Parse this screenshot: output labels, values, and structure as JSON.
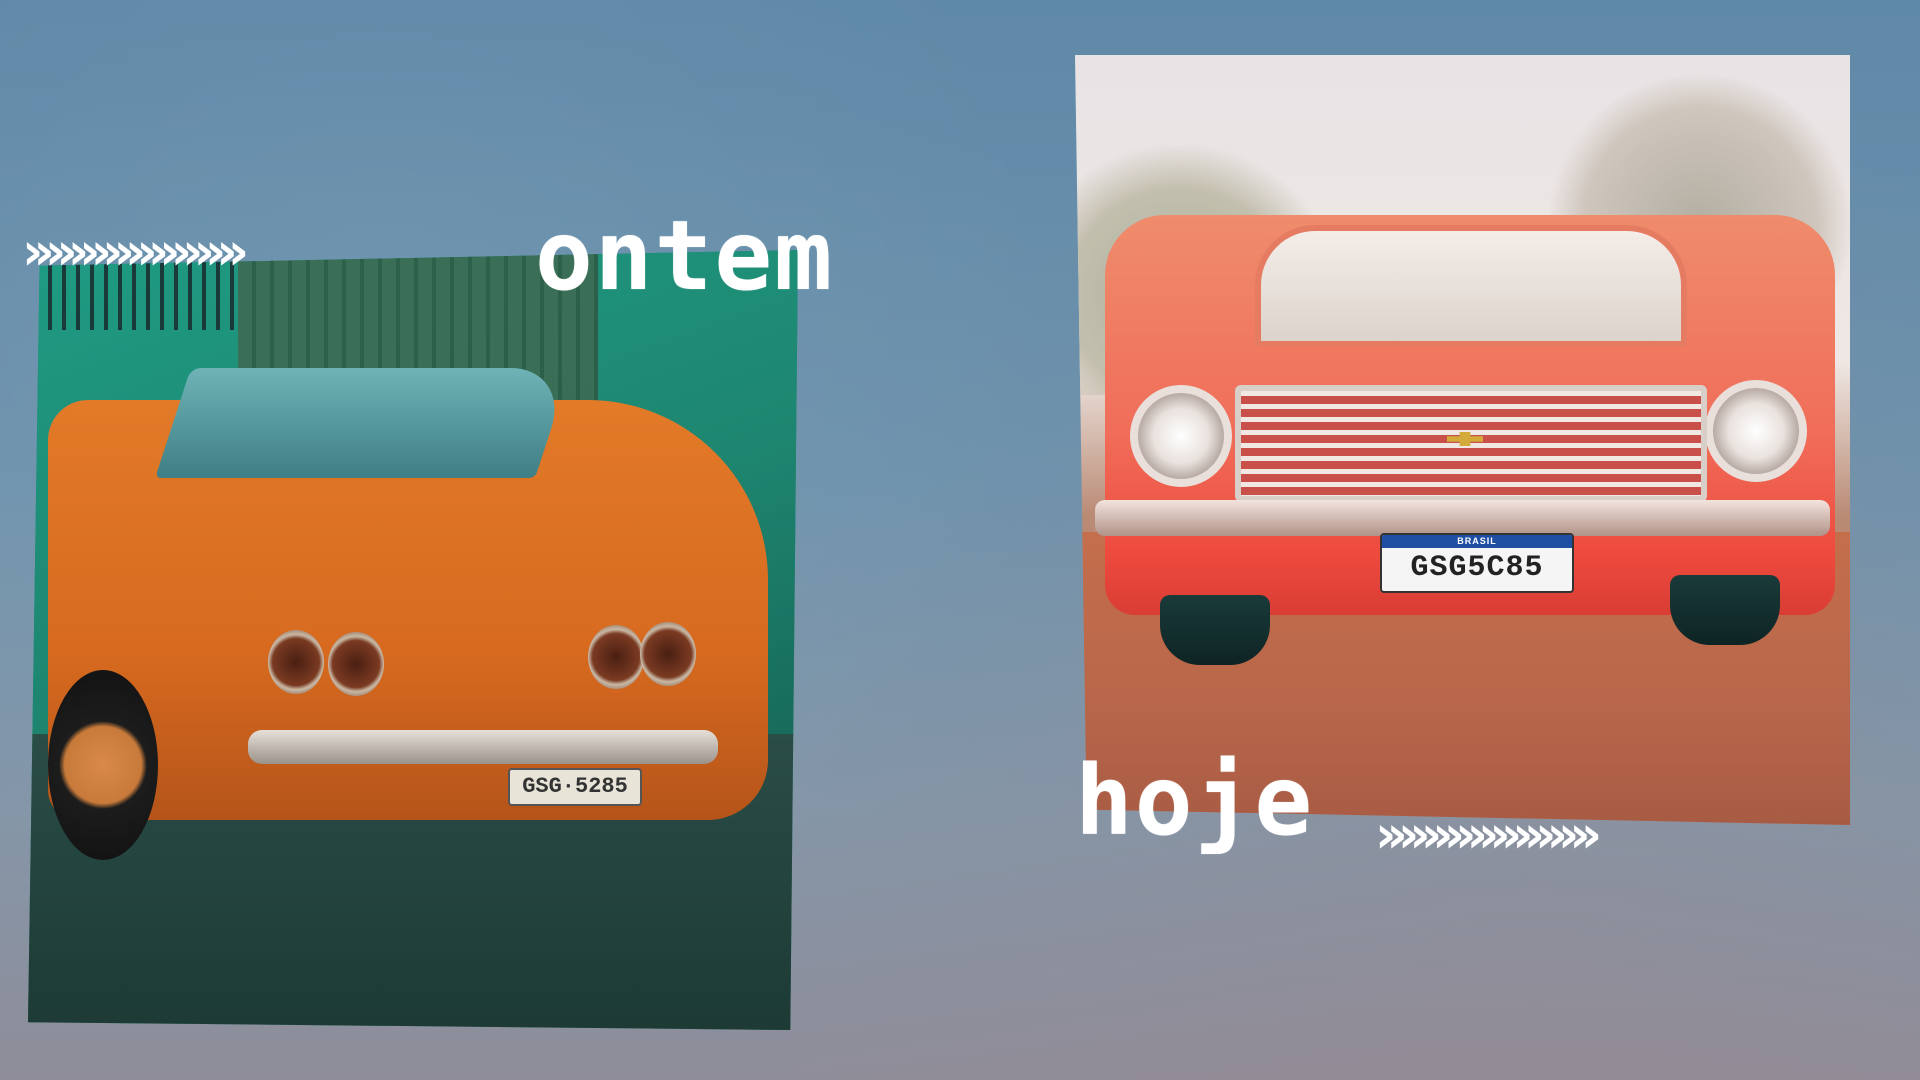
{
  "labels": {
    "left": "ontem",
    "right": "hoje"
  },
  "arrows": {
    "left": "›››››››››››››››››››",
    "right": "›››››››››››››››››››"
  },
  "photos": {
    "left": {
      "plate_text": "GSG·5285"
    },
    "right": {
      "plate_band": "BRASIL",
      "plate_text": "GSG5C85"
    }
  },
  "colors": {
    "background": "#6f93ad",
    "label": "#ffffff"
  }
}
